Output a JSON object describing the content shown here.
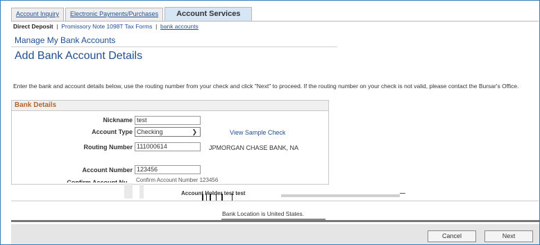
{
  "tabs": [
    {
      "label": "Account Inquiry"
    },
    {
      "label": "Electronic Payments/Purchases"
    },
    {
      "label": "Account Services"
    }
  ],
  "subnav": {
    "current": "Direct Deposit",
    "sep": "|",
    "link1": "Promissory Note 1098T Tax Forms",
    "link2": "bank accounts"
  },
  "page": {
    "section_title": "Manage My Bank Accounts",
    "heading": "Add Bank Account Details",
    "instructions": "Enter the bank and account details below, use the routing number from your check and click \"Next\" to proceed. If the routing number on your check is not valid, please contact the Bursar's Office."
  },
  "bank_details": {
    "header": "Bank Details",
    "nickname_label": "Nickname",
    "nickname_value": "test",
    "account_type_label": "Account Type",
    "account_type_value": "Checking",
    "view_sample": "View Sample Check",
    "routing_label": "Routing Number",
    "routing_value": "111000614",
    "bank_name": "JPMORGAN CHASE BANK, NA",
    "account_number_label": "Account Number",
    "account_number_value": "123456",
    "confirm_label_partial": "Confirm Account Nu...",
    "glitch_confirm": "Confirm Account Number 123456",
    "glitch_holder": "Account Holder test test"
  },
  "footer": {
    "bank_location": "Bank Location is United States.",
    "cancel": "Cancel",
    "next": "Next"
  }
}
